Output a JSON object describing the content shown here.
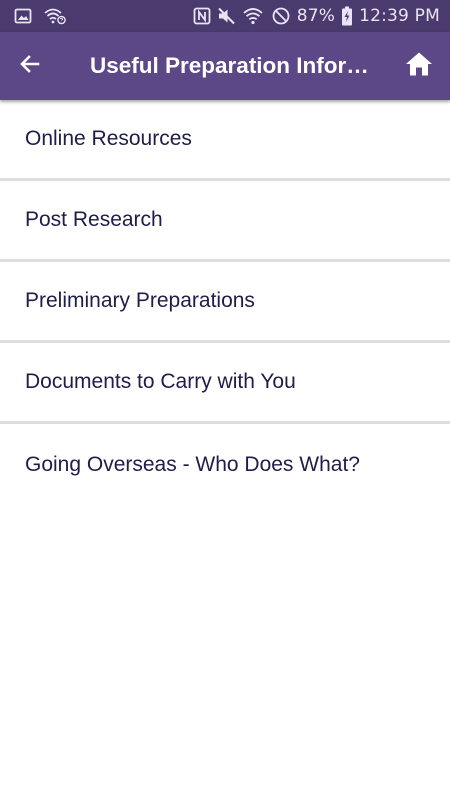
{
  "status_bar": {
    "battery": "87%",
    "time": "12:39 PM",
    "icons": [
      "image-icon",
      "wifi-question-icon",
      "nfc-icon",
      "mute-icon",
      "wifi-icon",
      "block-icon",
      "battery-charging-icon"
    ]
  },
  "app_bar": {
    "title": "Useful Preparation Infor…",
    "back_icon": "arrow-left-icon",
    "home_icon": "home-icon"
  },
  "list": {
    "items": [
      {
        "label": "Online Resources"
      },
      {
        "label": "Post Research"
      },
      {
        "label": "Preliminary Preparations"
      },
      {
        "label": "Documents to Carry with You"
      },
      {
        "label": "Going Overseas - Who Does What?"
      }
    ]
  },
  "colors": {
    "status_bar": "#4a3a6e",
    "app_bar": "#5c4787",
    "item_text": "#1f1d4a",
    "divider": "#dedede"
  }
}
